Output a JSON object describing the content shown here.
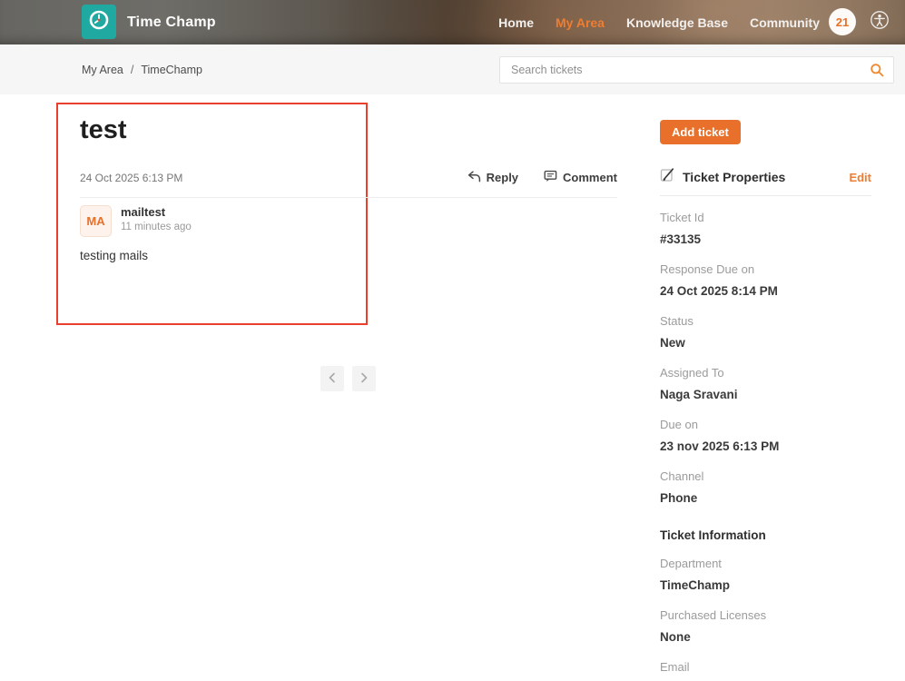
{
  "nav": {
    "brand": "Time Champ",
    "items": [
      {
        "label": "Home"
      },
      {
        "label": "My Area"
      },
      {
        "label": "Knowledge Base"
      },
      {
        "label": "Community"
      }
    ],
    "badge_count": "21"
  },
  "breadcrumb": {
    "items": [
      "My Area",
      "TimeChamp"
    ],
    "separator": "/"
  },
  "search": {
    "placeholder": "Search tickets"
  },
  "ticket": {
    "title": "test",
    "created": "24 Oct 2025 6:13 PM",
    "reply_label": "Reply",
    "comment_label": "Comment",
    "thread": {
      "avatar_initials": "MA",
      "author": "mailtest",
      "time_ago": "11 minutes ago",
      "body": "testing mails"
    }
  },
  "sidebar": {
    "add_ticket_label": "Add ticket",
    "properties_title": "Ticket Properties",
    "edit_label": "Edit",
    "properties": [
      {
        "label": "Ticket Id",
        "value": "#33135"
      },
      {
        "label": "Response Due on",
        "value": "24 Oct 2025 8:14 PM"
      },
      {
        "label": "Status",
        "value": "New"
      },
      {
        "label": "Assigned To",
        "value": "Naga Sravani"
      },
      {
        "label": "Due on",
        "value": "23 nov 2025 6:13 PM"
      },
      {
        "label": "Channel",
        "value": "Phone"
      }
    ],
    "info_title": "Ticket Information",
    "info": [
      {
        "label": "Department",
        "value": "TimeChamp"
      },
      {
        "label": "Purchased Licenses",
        "value": "None"
      },
      {
        "label": "Email",
        "value": ""
      }
    ]
  },
  "colors": {
    "accent_orange": "#e8702a",
    "brand_teal": "#1fa9a0",
    "annotation_red": "#e8402d"
  }
}
